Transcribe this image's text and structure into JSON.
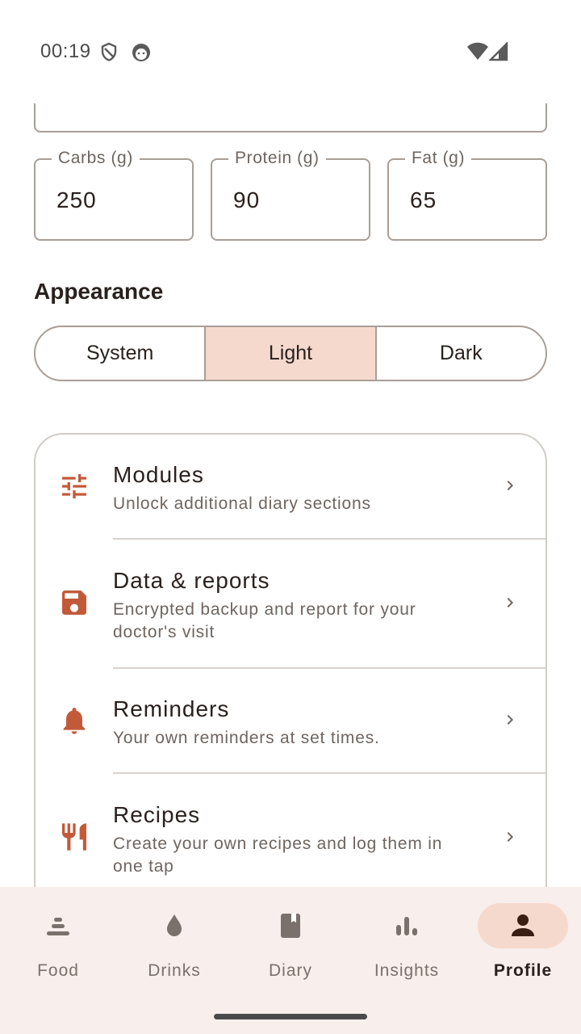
{
  "status_bar": {
    "time": "00:19",
    "icons": [
      "shield-icon",
      "cat-face-icon",
      "wifi-icon",
      "signal-icon"
    ]
  },
  "nutrition": {
    "fields": [
      {
        "label": "Carbs (g)",
        "value": "250"
      },
      {
        "label": "Protein (g)",
        "value": "90"
      },
      {
        "label": "Fat (g)",
        "value": "65"
      }
    ]
  },
  "appearance": {
    "title": "Appearance",
    "options": [
      "System",
      "Light",
      "Dark"
    ],
    "selected": "Light"
  },
  "settings_list": [
    {
      "icon": "tune-sliders-icon",
      "title": "Modules",
      "subtitle": "Unlock additional diary sections"
    },
    {
      "icon": "save-icon",
      "title": "Data & reports",
      "subtitle": "Encrypted backup and report for your doctor's visit"
    },
    {
      "icon": "bell-icon",
      "title": "Reminders",
      "subtitle": "Your own reminders at set times."
    },
    {
      "icon": "restaurant-icon",
      "title": "Recipes",
      "subtitle": "Create your own recipes and log them in one tap"
    }
  ],
  "bottom_nav": {
    "items": [
      {
        "label": "Food",
        "icon": "food-stack-icon"
      },
      {
        "label": "Drinks",
        "icon": "drop-icon"
      },
      {
        "label": "Diary",
        "icon": "diary-icon"
      },
      {
        "label": "Insights",
        "icon": "bar-chart-icon"
      },
      {
        "label": "Profile",
        "icon": "person-icon"
      }
    ],
    "active": "Profile"
  },
  "colors": {
    "accent": "#c25a3a",
    "selected_bg": "#f6d9cd",
    "nav_bg": "#f8eeeb",
    "outline": "#a89e98"
  }
}
